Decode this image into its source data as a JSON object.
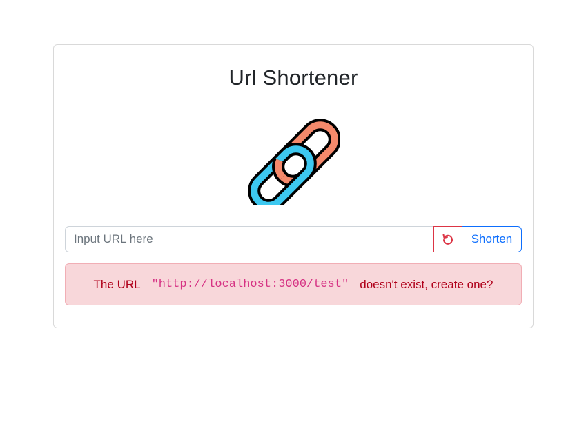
{
  "page": {
    "title": "Url Shortener",
    "logo_icon": "chain-link-icon"
  },
  "form": {
    "input_placeholder": "Input URL here",
    "input_value": "",
    "reset_icon": "undo-icon",
    "shorten_label": "Shorten"
  },
  "alert": {
    "prefix": "The URL",
    "url": "\"http://localhost:3000/test\"",
    "suffix": "doesn't exist, create one?"
  },
  "colors": {
    "link_top": "#F4896B",
    "link_bottom": "#3DC8F0",
    "primary": "#0d6efd",
    "danger": "#dc3545",
    "alert_bg": "#f8d7da",
    "alert_text": "#b0001a",
    "code_text": "#d63384"
  }
}
